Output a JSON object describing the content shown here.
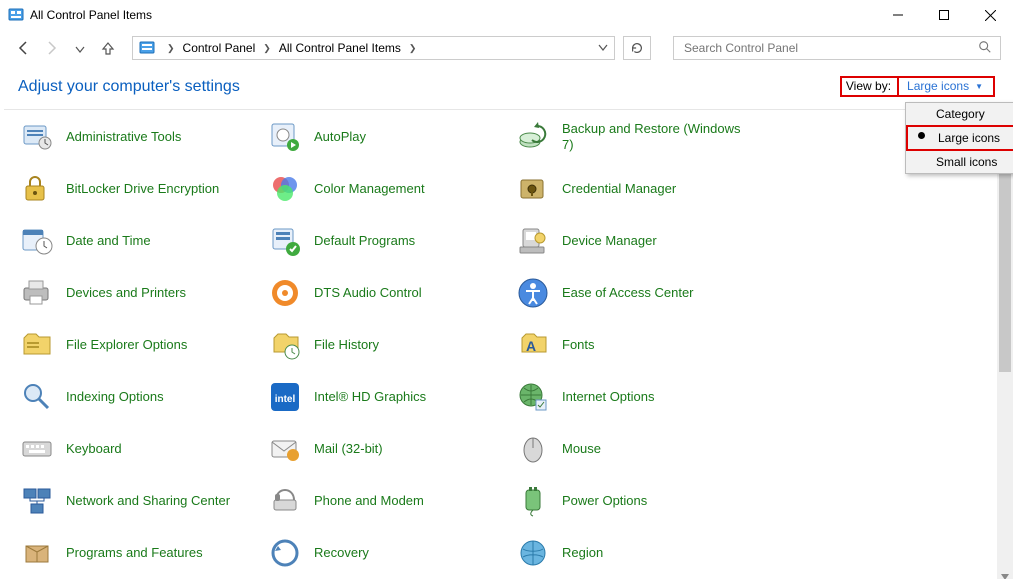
{
  "window": {
    "title": "All Control Panel Items"
  },
  "breadcrumb": {
    "root": "Control Panel",
    "current": "All Control Panel Items"
  },
  "search": {
    "placeholder": "Search Control Panel"
  },
  "header": {
    "title": "Adjust your computer's settings"
  },
  "viewby": {
    "label": "View by:",
    "value": "Large icons",
    "options": [
      "Category",
      "Large icons",
      "Small icons"
    ],
    "selected_index": 1
  },
  "items": [
    {
      "name": "Administrative Tools"
    },
    {
      "name": "AutoPlay"
    },
    {
      "name": "Backup and Restore (Windows 7)"
    },
    {
      "name": "BitLocker Drive Encryption"
    },
    {
      "name": "Color Management"
    },
    {
      "name": "Credential Manager"
    },
    {
      "name": "Date and Time"
    },
    {
      "name": "Default Programs"
    },
    {
      "name": "Device Manager"
    },
    {
      "name": "Devices and Printers"
    },
    {
      "name": "DTS Audio Control"
    },
    {
      "name": "Ease of Access Center"
    },
    {
      "name": "File Explorer Options"
    },
    {
      "name": "File History"
    },
    {
      "name": "Fonts"
    },
    {
      "name": "Indexing Options"
    },
    {
      "name": "Intel® HD Graphics"
    },
    {
      "name": "Internet Options"
    },
    {
      "name": "Keyboard"
    },
    {
      "name": "Mail (32-bit)"
    },
    {
      "name": "Mouse"
    },
    {
      "name": "Network and Sharing Center"
    },
    {
      "name": "Phone and Modem"
    },
    {
      "name": "Power Options"
    },
    {
      "name": "Programs and Features"
    },
    {
      "name": "Recovery"
    },
    {
      "name": "Region"
    }
  ]
}
